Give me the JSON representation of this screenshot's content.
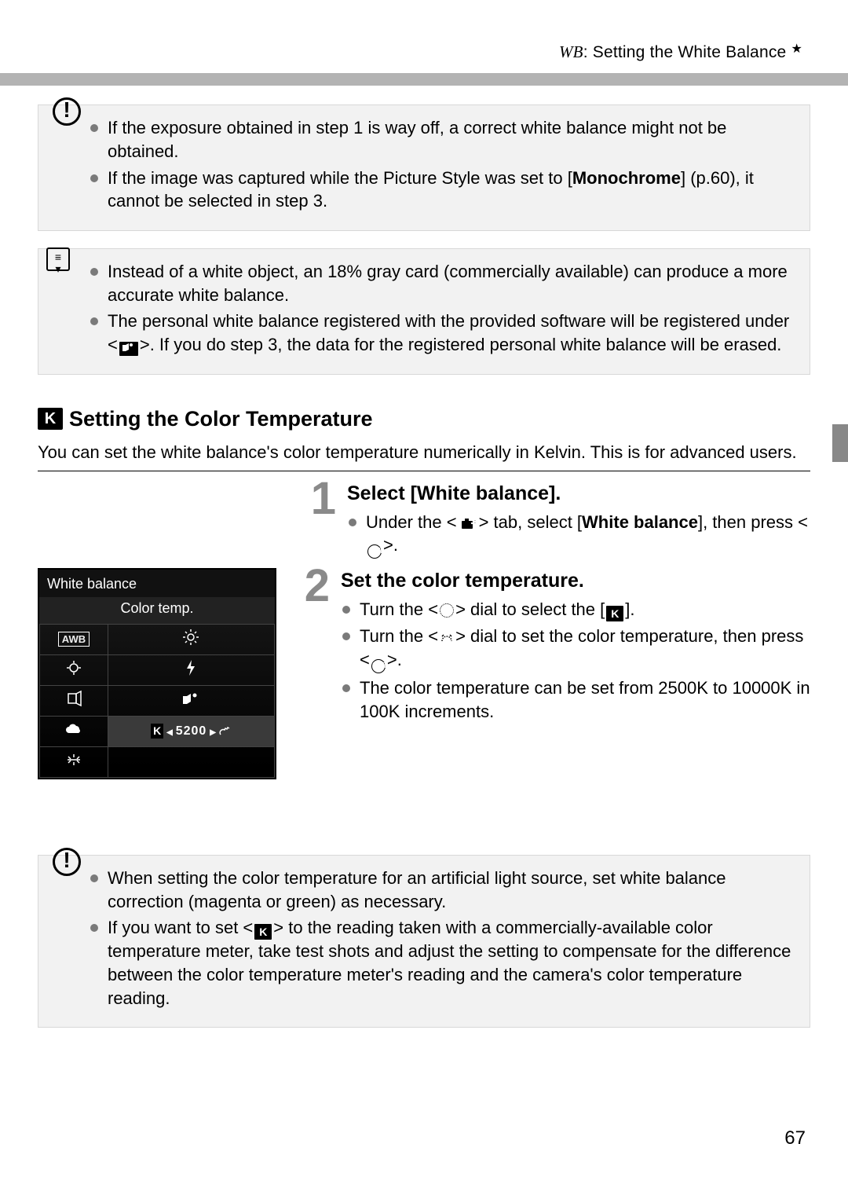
{
  "header": {
    "wb_label": "WB",
    "title_rest": ": Setting the White Balance",
    "star": "★"
  },
  "caution1": {
    "items": [
      "If the exposure obtained in step 1 is way off, a correct white balance might not be obtained.",
      "If the image was captured while the Picture Style was set to [Monochrome] (p.60), it cannot be selected in step 3."
    ]
  },
  "note1": {
    "items": [
      "Instead of a white object, an 18% gray card (commercially available) can produce a more accurate white balance.",
      "The personal white balance registered with the provided software will be registered under <  >. If you do step 3, the data for the registered personal white balance will be erased."
    ],
    "item1_pre": "The personal white balance registered with the provided software will be registered under <",
    "item1_post": ">. If you do step 3, the data for the registered personal white balance will be erased."
  },
  "section": {
    "heading": "Setting the Color Temperature",
    "intro": "You can set the white balance's color temperature numerically in Kelvin. This is for advanced users."
  },
  "steps": {
    "one": {
      "num": "1",
      "title": "Select [White balance].",
      "line1_pre": "Under the <",
      "line1_post": "> tab, select [",
      "line1_bold": "White balance",
      "line1_end": "], then press <",
      "line1_close": ">."
    },
    "two": {
      "num": "2",
      "title": "Set the color temperature.",
      "b1_pre": "Turn the <",
      "b1_mid": "> dial to select the [",
      "b1_post": "].",
      "b2_pre": "Turn the <",
      "b2_mid": "> dial to set the color temperature, then press <",
      "b2_post": ">.",
      "b3": "The color temperature can be set from 2500K to 10000K in 100K increments."
    }
  },
  "lcd": {
    "header": "White balance",
    "sub": "Color temp.",
    "awb": "AWB",
    "reading_prefix": "K",
    "reading_value": "5200"
  },
  "caution2": {
    "item1": "When setting the color temperature for an artificial light source, set white balance correction (magenta or green) as necessary.",
    "item2_pre": "If you want to set <",
    "item2_post": "> to the reading taken with a commercially-available color temperature meter, take test shots and adjust the setting to compensate for the difference between the color temperature meter's reading and the camera's color temperature reading."
  },
  "pagenum": "67"
}
